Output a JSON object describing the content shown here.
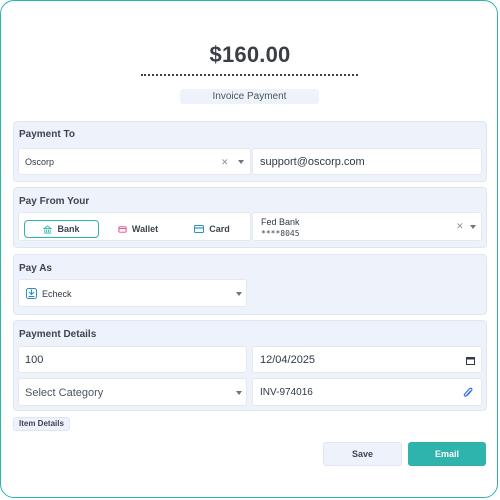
{
  "header": {
    "amount": "$160.00",
    "memo": "Invoice Payment"
  },
  "payment_to": {
    "title": "Payment To",
    "payee": "Oscorp",
    "email": "support@oscorp.com"
  },
  "pay_from": {
    "title": "Pay From Your",
    "tabs": [
      {
        "label": "Bank",
        "icon": "bank-icon",
        "active": true
      },
      {
        "label": "Wallet",
        "icon": "wallet-icon",
        "active": false
      },
      {
        "label": "Card",
        "icon": "card-icon",
        "active": false
      }
    ],
    "account_name": "Fed Bank",
    "account_number": "****8045"
  },
  "pay_as": {
    "title": "Pay As",
    "method": "Echeck"
  },
  "payment_details": {
    "title": "Payment Details",
    "amount_value": "100",
    "date_value": "12/04/2025",
    "category_placeholder": "Select Category",
    "invoice_value": "INV-974016"
  },
  "item_details_label": "Item Details",
  "actions": {
    "save_label": "Save",
    "email_label": "Email"
  },
  "colors": {
    "accent": "#2eb3ad",
    "section_bg": "#eef3fb",
    "wallet_icon": "#e0448a",
    "link_icon": "#2f6de1"
  }
}
